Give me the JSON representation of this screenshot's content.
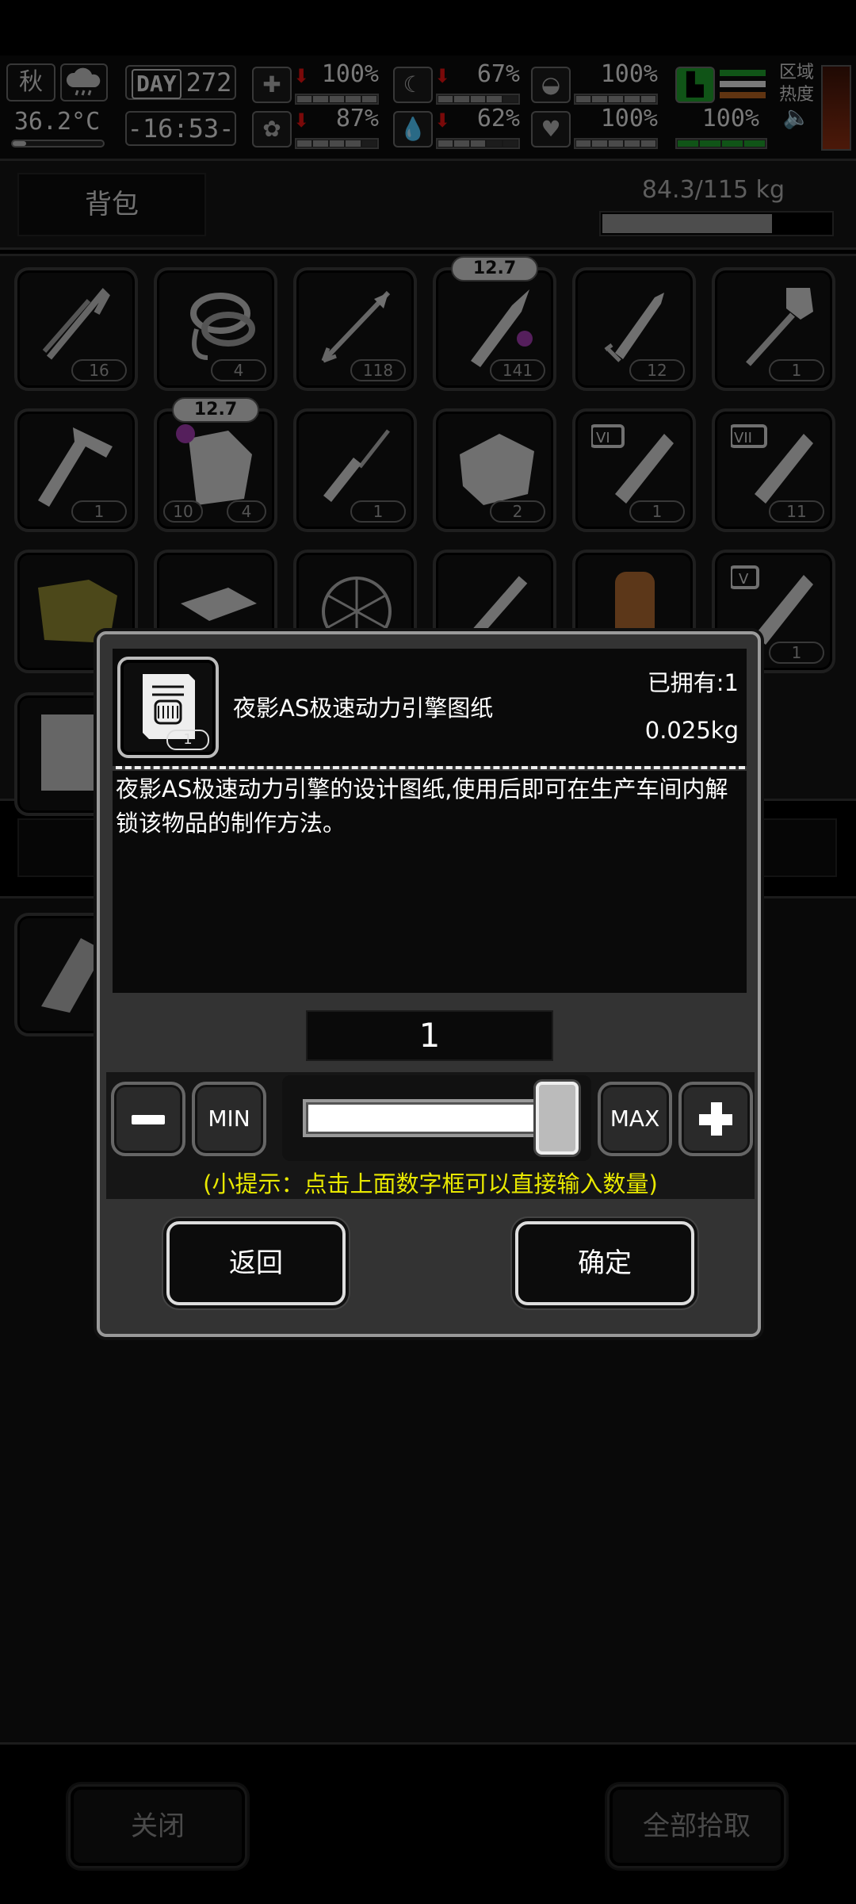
{
  "status": {
    "season": "秋",
    "temperature": "36.2°C",
    "day_label": "DAY",
    "day": "272",
    "time": "-16:53-",
    "stats": [
      {
        "icon": "medkit-icon",
        "value": "100%"
      },
      {
        "icon": "stomach-icon",
        "value": "67%"
      },
      {
        "icon": "sleep-icon",
        "value": "100%"
      },
      {
        "icon": "brain-icon",
        "value": "87%"
      },
      {
        "icon": "water-drop-icon",
        "value": "62%"
      },
      {
        "icon": "heart-icon",
        "value": "100%"
      }
    ],
    "stamina": "100%",
    "zone_label": "区域热度",
    "colors": {
      "down_arrow": "#dd1111",
      "stamina": "#1e9a2a",
      "zone_heat": "#8a2e12"
    }
  },
  "backpack": {
    "title": "背包",
    "weight": "84.3/115 kg",
    "weight_fill": 0.733,
    "items": [
      {
        "name": "lockpick",
        "qty": "16"
      },
      {
        "name": "rope",
        "qty": "4"
      },
      {
        "name": "arrow",
        "qty": "118"
      },
      {
        "name": "ammo-12-7",
        "qty": "141",
        "tag": "12.7"
      },
      {
        "name": "rocket",
        "qty": "12"
      },
      {
        "name": "shovel",
        "qty": "1"
      },
      {
        "name": "hammer-tool",
        "qty": "1"
      },
      {
        "name": "ammo-box",
        "qty": "4",
        "qty_left": "10",
        "tag": "12.7"
      },
      {
        "name": "screwdriver",
        "qty": "1"
      },
      {
        "name": "cloth",
        "qty": "2"
      },
      {
        "name": "potion-vi",
        "qty": "1"
      },
      {
        "name": "potion-vii",
        "qty": "11"
      },
      {
        "name": "potion-v",
        "qty": "1"
      }
    ]
  },
  "footer": {
    "close": "关闭",
    "take_all": "全部拾取"
  },
  "dialog": {
    "item_name": "夜影AS极速动力引擎图纸",
    "item_qty": "1",
    "owned": "已拥有:1",
    "weight": "0.025kg",
    "description": "夜影AS极速动力引擎的设计图纸,使用后即可在生产车间内解锁该物品的制作方法。",
    "count": "1",
    "min_label": "MIN",
    "max_label": "MAX",
    "slider_level": 1.0,
    "hint": "(小提示：点击上面数字框可以直接输入数量)",
    "back": "返回",
    "confirm": "确定",
    "hint_color": "#e8e800"
  }
}
